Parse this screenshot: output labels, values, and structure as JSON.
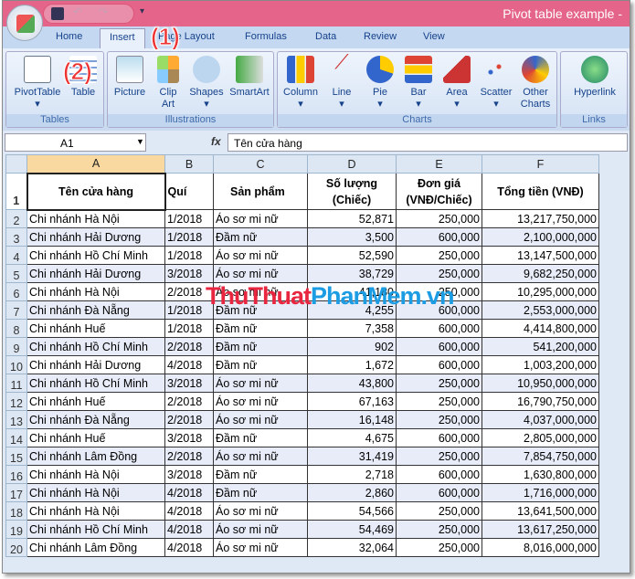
{
  "window_title": "Pivot table example -",
  "tabs": [
    "Home",
    "Insert",
    "Page Layout",
    "Formulas",
    "Data",
    "Review",
    "View"
  ],
  "active_tab": "Insert",
  "ribbon": {
    "tables": {
      "label": "Tables",
      "buttons": [
        "PivotTable",
        "Table"
      ]
    },
    "illustrations": {
      "label": "Illustrations",
      "buttons": [
        "Picture",
        "Clip Art",
        "Shapes",
        "SmartArt"
      ]
    },
    "charts": {
      "label": "Charts",
      "buttons": [
        "Column",
        "Line",
        "Pie",
        "Bar",
        "Area",
        "Scatter",
        "Other Charts"
      ]
    },
    "links": {
      "label": "Links",
      "buttons": [
        "Hyperlink"
      ]
    }
  },
  "annotations": [
    "(1)",
    "(2)"
  ],
  "formula_bar": {
    "name_box": "A1",
    "fx": "fx",
    "formula": "Tên cửa hàng"
  },
  "columns": [
    "A",
    "B",
    "C",
    "D",
    "E",
    "F"
  ],
  "headers": [
    "Tên cửa hàng",
    "Quí",
    "Sản phẩm",
    "Số lượng (Chiếc)",
    "Đơn giá (VNĐ/Chiếc)",
    "Tổng tiền (VNĐ)"
  ],
  "rows": [
    [
      "Chi nhánh Hà Nội",
      "1/2018",
      "Áo sơ mi nữ",
      "52,871",
      "250,000",
      "13,217,750,000"
    ],
    [
      "Chi nhánh Hải Dương",
      "1/2018",
      "Đầm nữ",
      "3,500",
      "600,000",
      "2,100,000,000"
    ],
    [
      "Chi nhánh Hồ Chí Minh",
      "1/2018",
      "Áo sơ mi nữ",
      "52,590",
      "250,000",
      "13,147,500,000"
    ],
    [
      "Chi nhánh Hải Dương",
      "3/2018",
      "Áo sơ mi nữ",
      "38,729",
      "250,000",
      "9,682,250,000"
    ],
    [
      "Chi nhánh Hà Nội",
      "2/2018",
      "Áo sơ mi nữ",
      "41,180",
      "250,000",
      "10,295,000,000"
    ],
    [
      "Chi nhánh Đà Nẵng",
      "1/2018",
      "Đầm nữ",
      "4,255",
      "600,000",
      "2,553,000,000"
    ],
    [
      "Chi nhánh Huế",
      "1/2018",
      "Đầm nữ",
      "7,358",
      "600,000",
      "4,414,800,000"
    ],
    [
      "Chi nhánh Hồ Chí Minh",
      "2/2018",
      "Đầm nữ",
      "902",
      "600,000",
      "541,200,000"
    ],
    [
      "Chi nhánh Hải Dương",
      "4/2018",
      "Đầm nữ",
      "1,672",
      "600,000",
      "1,003,200,000"
    ],
    [
      "Chi nhánh Hồ Chí Minh",
      "3/2018",
      "Áo sơ mi nữ",
      "43,800",
      "250,000",
      "10,950,000,000"
    ],
    [
      "Chi nhánh Huế",
      "2/2018",
      "Áo sơ mi nữ",
      "67,163",
      "250,000",
      "16,790,750,000"
    ],
    [
      "Chi nhánh Đà Nẵng",
      "2/2018",
      "Áo sơ mi nữ",
      "16,148",
      "250,000",
      "4,037,000,000"
    ],
    [
      "Chi nhánh Huế",
      "3/2018",
      "Đầm nữ",
      "4,675",
      "600,000",
      "2,805,000,000"
    ],
    [
      "Chi nhánh Lâm Đồng",
      "2/2018",
      "Áo sơ mi nữ",
      "31,419",
      "250,000",
      "7,854,750,000"
    ],
    [
      "Chi nhánh Hà Nội",
      "3/2018",
      "Đầm nữ",
      "2,718",
      "600,000",
      "1,630,800,000"
    ],
    [
      "Chi nhánh Hà Nội",
      "4/2018",
      "Đầm nữ",
      "2,860",
      "600,000",
      "1,716,000,000"
    ],
    [
      "Chi nhánh Hà Nội",
      "4/2018",
      "Áo sơ mi nữ",
      "54,566",
      "250,000",
      "13,641,500,000"
    ],
    [
      "Chi nhánh Hồ Chí Minh",
      "4/2018",
      "Áo sơ mi nữ",
      "54,469",
      "250,000",
      "13,617,250,000"
    ],
    [
      "Chi nhánh Lâm Đồng",
      "4/2018",
      "Áo sơ mi nữ",
      "32,064",
      "250,000",
      "8,016,000,000"
    ]
  ],
  "watermark": {
    "part1": "ThuThuat",
    "part2": "PhanMem",
    "part3": ".vn"
  }
}
